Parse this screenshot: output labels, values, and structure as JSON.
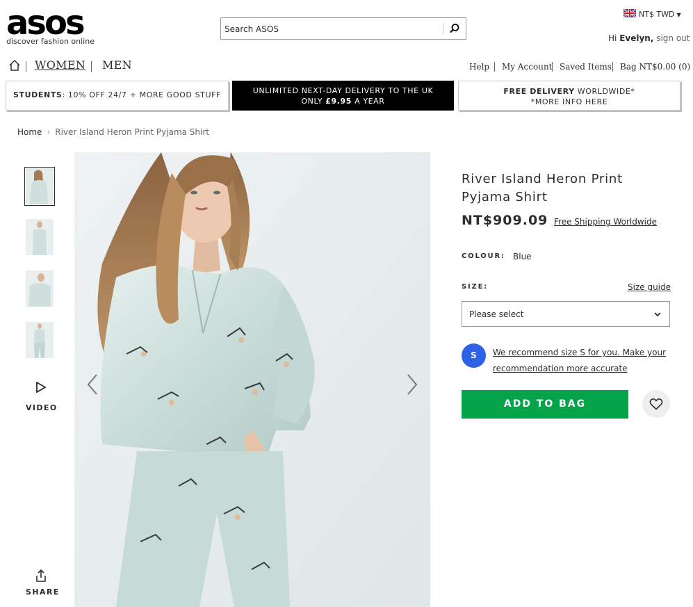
{
  "header": {
    "logo": "asos",
    "tagline": "discover fashion online",
    "search_placeholder": "Search ASOS",
    "currency": "NT$ TWD",
    "greeting_prefix": "Hi",
    "user_name": "Evelyn,",
    "sign_out": "sign out"
  },
  "nav": {
    "women": "WOMEN",
    "men": "MEN",
    "help": "Help",
    "my_account": "My Account",
    "saved_items": "Saved Items",
    "bag": "Bag NT$0.00 (0)"
  },
  "banners": {
    "students_bold": "STUDENTS",
    "students_text": ": 10% OFF 24/7 + MORE GOOD STUFF",
    "delivery_line1": "UNLIMITED NEXT-DAY DELIVERY TO THE UK",
    "delivery_line2_prefix": "ONLY ",
    "delivery_line2_price": "£9.95",
    "delivery_line2_suffix": " A YEAR",
    "free_bold": "FREE DELIVERY",
    "free_text": " WORLDWIDE*",
    "free_line2": "*MORE INFO HERE"
  },
  "breadcrumb": {
    "home": "Home",
    "separator": "›",
    "current": "River Island Heron Print Pyjama Shirt"
  },
  "gallery": {
    "video_label": "VIDEO",
    "share_label": "SHARE"
  },
  "product": {
    "title": "River Island Heron Print Pyjama Shirt",
    "price": "NT$909.09",
    "shipping": "Free Shipping Worldwide",
    "colour_label": "COLOUR:",
    "colour_value": "Blue",
    "size_label": "SIZE:",
    "size_guide": "Size guide",
    "size_placeholder": "Please select",
    "rec_badge": "S",
    "recommendation": "We recommend size S for you. Make your recommendation more accurate",
    "add_to_bag": "ADD TO BAG"
  },
  "colors": {
    "accent_green": "#05a34a",
    "rec_blue": "#2d62e8",
    "text": "#2d2d2d"
  }
}
